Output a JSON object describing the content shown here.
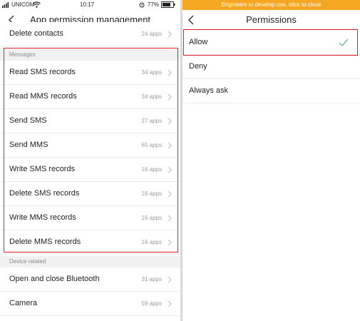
{
  "left": {
    "status_bar": {
      "carrier": "UNICOM",
      "time": "10:17",
      "battery": "77%"
    },
    "header": {
      "title": "App permission management"
    },
    "list": [
      {
        "kind": "row",
        "label": "Delete contacts",
        "count": "24 apps"
      },
      {
        "kind": "section",
        "label": "Messages"
      },
      {
        "kind": "row",
        "label": "Read SMS records",
        "count": "34 apps"
      },
      {
        "kind": "row",
        "label": "Read MMS records",
        "count": "34 apps"
      },
      {
        "kind": "row",
        "label": "Send SMS",
        "count": "27 apps"
      },
      {
        "kind": "row",
        "label": "Send MMS",
        "count": "65 apps"
      },
      {
        "kind": "row",
        "label": "Write SMS records",
        "count": "16 apps"
      },
      {
        "kind": "row",
        "label": "Delete SMS records",
        "count": "16 apps"
      },
      {
        "kind": "row",
        "label": "Write MMS records",
        "count": "16 apps"
      },
      {
        "kind": "row",
        "label": "Delete MMS records",
        "count": "16 apps"
      },
      {
        "kind": "section",
        "label": "Device related"
      },
      {
        "kind": "row",
        "label": "Open and close Bluetooth",
        "count": "31 apps"
      },
      {
        "kind": "row",
        "label": "Camera",
        "count": "59 apps"
      }
    ]
  },
  "right": {
    "banner": "Engineers to develop use, click to close",
    "header": {
      "title": "Permissions"
    },
    "options": [
      {
        "label": "Allow",
        "selected": true
      },
      {
        "label": "Deny",
        "selected": false
      },
      {
        "label": "Always ask",
        "selected": false
      }
    ]
  },
  "colors": {
    "highlight": "#e02020",
    "banner": "#f5a623",
    "check": "#4caf82",
    "section_bg": "#f1f1f1"
  }
}
